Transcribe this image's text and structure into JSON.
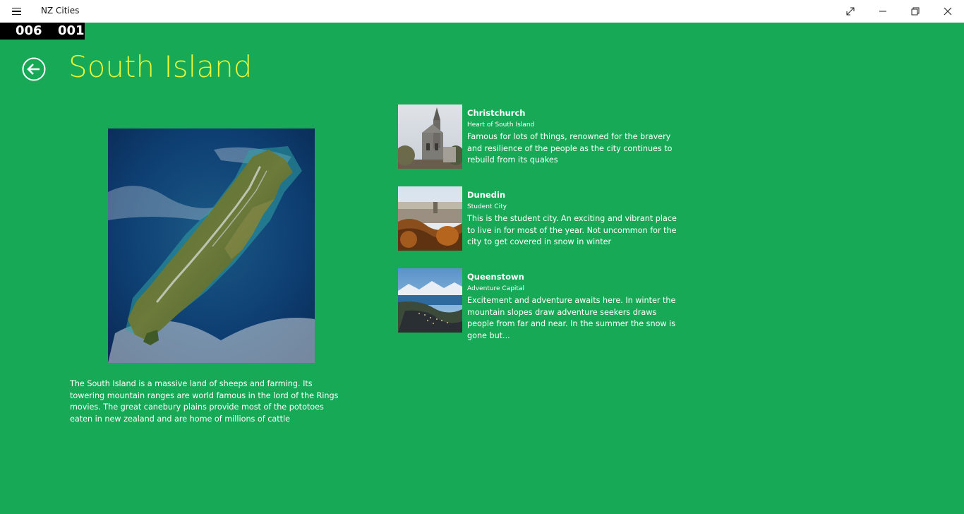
{
  "window": {
    "app_title": "NZ Cities"
  },
  "counter": {
    "left": "006",
    "right": "001"
  },
  "header": {
    "title": "South Island"
  },
  "island": {
    "description": "The South Island is a massive land of sheeps and farming. Its towering mountain ranges are world famous in the lord of the Rings movies. The great canebury plains provide most of the pototoes eaten in new zealand and are home of millions of cattle"
  },
  "cities": [
    {
      "name": "Christchurch",
      "tagline": "Heart of South Island",
      "description": "Famous for lots of things, renowned for the bravery and resilience of the people as the city continues to rebuild from its quakes"
    },
    {
      "name": "Dunedin",
      "tagline": "Student City",
      "description": "This is the student city. An exciting and vibrant place to live in for most of the year. Not uncommon for the city to get covered in snow in winter"
    },
    {
      "name": "Queenstown",
      "tagline": "Adventure Capital",
      "description": "Excitement and adventure awaits here. In winter the mountain slopes draw adventure seekers draws people from far and near. In the summer the snow is gone but..."
    }
  ],
  "colors": {
    "background": "#17a956",
    "title": "#e6f53a",
    "titlebar": "#ffffff"
  },
  "icons": [
    "hamburger-menu-icon",
    "fullscreen-icon",
    "minimize-icon",
    "restore-icon",
    "close-icon",
    "back-arrow-icon"
  ]
}
